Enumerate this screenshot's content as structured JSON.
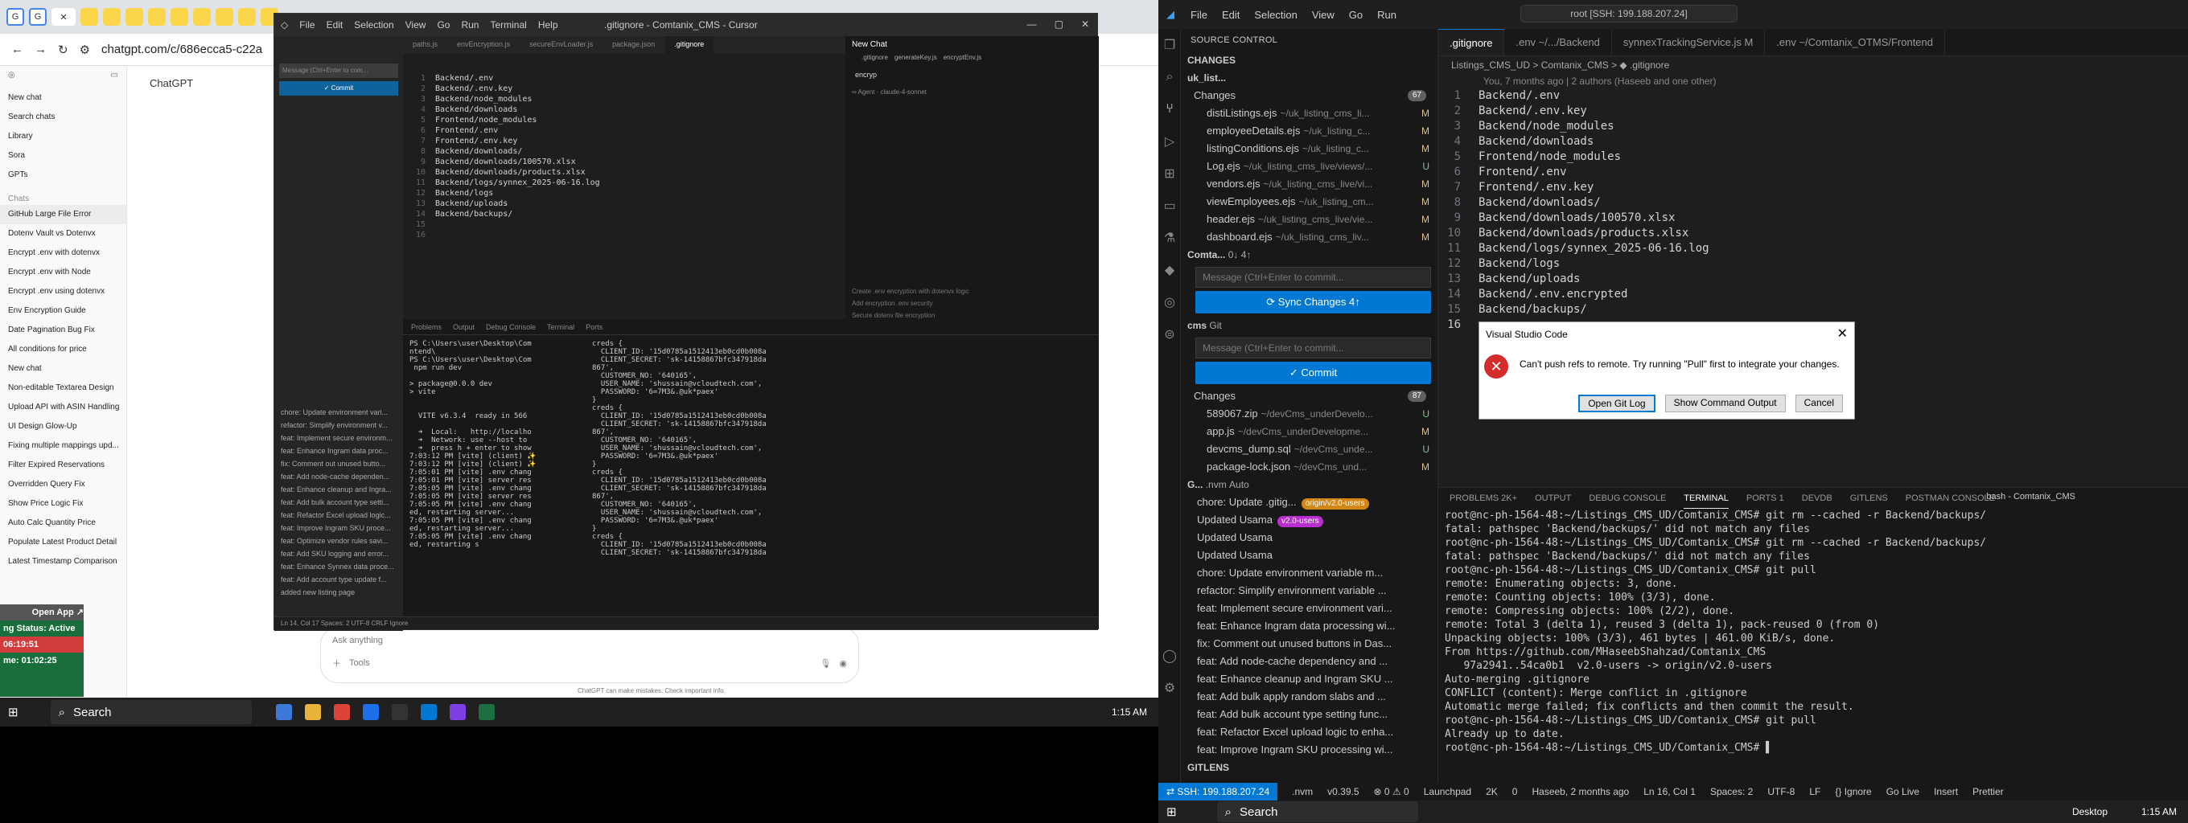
{
  "chrome": {
    "url": "chatgpt.com/c/686ecca5-c22a",
    "app_title": "ChatGPT"
  },
  "gpt_sidebar": {
    "top_items": [
      "New chat",
      "Search chats",
      "Library",
      "Sora",
      "GPTs"
    ],
    "chats_header": "Chats",
    "chats": [
      "GitHub Large File Error",
      "Dotenv Vault vs Dotenvx",
      "Encrypt .env with dotenvx",
      "Encrypt .env with Node",
      "Encrypt .env using dotenvx",
      "Env Encryption Guide",
      "Date Pagination Bug Fix",
      "All conditions for price",
      "New chat",
      "Non-editable Textarea Design",
      "Upload API with ASIN Handling",
      "UI Design Glow-Up",
      "Fixing multiple mappings upd...",
      "Filter Expired Reservations",
      "Overridden Query Fix",
      "Show Price Logic Fix",
      "Auto Calc Quantity Price",
      "Populate Latest Product Detail",
      "Latest Timestamp Comparison"
    ]
  },
  "gpt_main": {
    "input_placeholder": "Ask anything",
    "tools_label": "Tools",
    "footer": "ChatGPT can make mistakes. Check important info."
  },
  "status_widget": {
    "open_app": "Open App ↗",
    "status": "ng Status: Active",
    "time1": "06:19:51",
    "time2": "me: 01:02:25"
  },
  "cursor": {
    "menu": [
      "File",
      "Edit",
      "Selection",
      "View",
      "Go",
      "Run",
      "Terminal",
      "Help"
    ],
    "title": ".gitignore - Comtanix_CMS - Cursor",
    "tabs": [
      "paths.js",
      "envEncryption.js",
      "secureEnvLoader.js",
      "package.json",
      ".gitignore"
    ],
    "editor_lines": [
      "Backend/.env",
      "Backend/.env.key",
      "Backend/node_modules",
      "Backend/downloads",
      "Frontend/node_modules",
      "Frontend/.env",
      "Frontend/.env.key",
      "Backend/downloads/",
      "Backend/downloads/100570.xlsx",
      "Backend/downloads/products.xlsx",
      "Backend/logs/synnex_2025-06-16.log",
      "Backend/logs",
      "Backend/uploads",
      "Backend/backups/",
      "",
      ""
    ],
    "chat_title": "New Chat",
    "chat_tabs": [
      ".gitignore",
      "generateKey.js",
      "encryptEnv.js"
    ],
    "chat_input": "encryp",
    "chat_footer": [
      "Create .env encryption with dotenvx logic",
      "Add encryption .env security",
      "Secure dotenv file encryption"
    ],
    "term_tabs": [
      "Problems",
      "Output",
      "Debug Console",
      "Terminal",
      "Ports"
    ],
    "term_left": "PS C:\\Users\\user\\Desktop\\Com\nntend\\\nPS C:\\Users\\user\\Desktop\\Com\n npm run dev\n\n> package@0.0.0 dev\n> vite\n\n\n  VITE v6.3.4  ready in 566\n\n  ➜  Local:   http://localho\n  ➜  Network: use --host to\n  ➜  press h + enter to show\n7:03:12 PM [vite] (client) ✨\n7:03:12 PM [vite] (client) ✨\n7:05:01 PM [vite] .env chang\n7:05:01 PM [vite] server res\n7:05:05 PM [vite] .env chang\n7:05:05 PM [vite] server res\n7:05:05 PM [vite] .env chang\ned, restarting server...\n7:05:05 PM [vite] .env chang\ned, restarting server...\n7:05:05 PM [vite] .env chang\ned, restarting s",
    "term_right": "creds {\n  CLIENT_ID: '15d0785a1512413eb0cd0b008a\n  CLIENT_SECRET: 'sk-14158867bfc347918da\n867',\n  CUSTOMER_NO: '640165',\n  USER_NAME: 'shussain@vcloudtech.com',\n  PASSWORD: '6=7M3&.@uk*paex'\n}\ncreds {\n  CLIENT_ID: '15d0785a1512413eb0cd0b008a\n  CLIENT_SECRET: 'sk-14158867bfc347918da\n867',\n  CUSTOMER_NO: '640165',\n  USER_NAME: 'shussain@vcloudtech.com',\n  PASSWORD: '6=7M3&.@uk*paex'\n}\ncreds {\n  CLIENT_ID: '15d0785a1512413eb0cd0b008a\n  CLIENT_SECRET: 'sk-14158867bfc347918da\n867',\n  CUSTOMER_NO: '640165',\n  USER_NAME: 'shussain@vcloudtech.com',\n  PASSWORD: '6=7M3&.@uk*paex'\n}\ncreds {\n  CLIENT_ID: '15d0785a1512413eb0cd0b008a\n  CLIENT_SECRET: 'sk-14158867bfc347918da",
    "git_items": [
      "chore: Update environment vari...",
      "refactor: Simplify environment v...",
      "feat: Implement secure environm...",
      "feat: Enhance Ingram data proc...",
      "fix: Comment out unused butto...",
      "feat: Add node-cache dependen...",
      "feat: Enhance cleanup and Ingra...",
      "feat: Add bulk account type setti...",
      "feat: Refactor Excel upload logic...",
      "feat: Improve Ingram SKU proce...",
      "feat: Optimize vendor rules savi...",
      "feat: Add SKU logging and error...",
      "feat: Enhance Synnex data proce...",
      "feat: Add account type update f...",
      "added new listing page"
    ],
    "status": "Ln 14, Col 17   Spaces: 2   UTF-8   CRLF   Ignore"
  },
  "taskbar_left": {
    "search": "Search",
    "time": "1:15 AM"
  },
  "vscode": {
    "menu": [
      "File",
      "Edit",
      "Selection",
      "View",
      "Go",
      "Run"
    ],
    "command_center": "root [SSH: 199.188.207.24]",
    "sc_header": "SOURCE CONTROL",
    "changes_header": "CHANGES",
    "repo1": "uk_list...",
    "repo1_changes_label": "Changes",
    "repo1_badge": "67",
    "repo1_files": [
      {
        "name": "distiListings.ejs",
        "dir": "~/uk_listing_cms_li...",
        "st": "M"
      },
      {
        "name": "employeeDetails.ejs",
        "dir": "~/uk_listing_c...",
        "st": "M"
      },
      {
        "name": "listingConditions.ejs",
        "dir": "~/uk_listing_c...",
        "st": "M"
      },
      {
        "name": "Log.ejs",
        "dir": "~/uk_listing_cms_live/views/...",
        "st": "U"
      },
      {
        "name": "vendors.ejs",
        "dir": "~/uk_listing_cms_live/vi...",
        "st": "M"
      },
      {
        "name": "viewEmployees.ejs",
        "dir": "~/uk_listing_cm...",
        "st": "M"
      },
      {
        "name": "header.ejs",
        "dir": "~/uk_listing_cms_live/vie...",
        "st": "M"
      },
      {
        "name": "dashboard.ejs",
        "dir": "~/uk_listing_cms_liv...",
        "st": "M"
      }
    ],
    "repo2": "Comta...",
    "repo2_branch": "0↓ 4↑",
    "msg_placeholder": "Message (Ctrl+Enter to commit...",
    "sync_button": "⟳ Sync Changes 4↑",
    "repo3": "cms",
    "repo3_branch": "Git",
    "commit_button": "✓ Commit",
    "repo3_changes_label": "Changes",
    "repo3_badge": "87",
    "repo3_files": [
      {
        "name": "589067.zip",
        "dir": "~/devCms_underDevelo...",
        "st": "U"
      },
      {
        "name": "app.js",
        "dir": "~/devCms_underDevelopme...",
        "st": "M"
      },
      {
        "name": "devcms_dump.sql",
        "dir": "~/devCms_unde...",
        "st": "U"
      },
      {
        "name": "package-lock.json",
        "dir": "~/devCms_und...",
        "st": "M"
      }
    ],
    "graph_header": "G...",
    "graph_repo": ".nvm",
    "graph_mode": "Auto",
    "graph": [
      {
        "text": "chore: Update .gitig...",
        "tag": "origin/v2.0-users",
        "tagclass": ""
      },
      {
        "text": "Updated  Usama",
        "tag": "v2.0-users",
        "tagclass": "p"
      },
      {
        "text": "Updated  Usama",
        "tag": "",
        "tagclass": ""
      },
      {
        "text": "Updated  Usama",
        "tag": "",
        "tagclass": ""
      },
      {
        "text": "chore: Update environment variable m...",
        "tag": "",
        "tagclass": ""
      },
      {
        "text": "refactor: Simplify environment variable ...",
        "tag": "",
        "tagclass": ""
      },
      {
        "text": "feat: Implement secure environment vari...",
        "tag": "",
        "tagclass": ""
      },
      {
        "text": "feat: Enhance Ingram data processing wi...",
        "tag": "",
        "tagclass": ""
      },
      {
        "text": "fix: Comment out unused buttons in Das...",
        "tag": "",
        "tagclass": ""
      },
      {
        "text": "feat: Add node-cache dependency and ...",
        "tag": "",
        "tagclass": ""
      },
      {
        "text": "feat: Enhance cleanup and Ingram SKU ...",
        "tag": "",
        "tagclass": ""
      },
      {
        "text": "feat: Add bulk apply random slabs and ...",
        "tag": "",
        "tagclass": ""
      },
      {
        "text": "feat: Add bulk account type setting func...",
        "tag": "",
        "tagclass": ""
      },
      {
        "text": "feat: Refactor Excel upload logic to enha...",
        "tag": "",
        "tagclass": ""
      },
      {
        "text": "feat: Improve Ingram SKU processing wi...",
        "tag": "",
        "tagclass": ""
      }
    ],
    "gitlens": "GITLENS",
    "tabs": [
      ".gitignore",
      ".env ~/.../Backend",
      "synnexTrackingService.js M",
      ".env ~/Comtanix_OTMS/Frontend"
    ],
    "crumb": "Listings_CMS_UD > Comtanix_CMS > ◆ .gitignore",
    "blame": "You, 7 months ago | 2 authors (Haseeb and one other)",
    "code": [
      "Backend/.env",
      "Backend/.env.key",
      "Backend/node_modules",
      "Backend/downloads",
      "Frontend/node_modules",
      "Frontend/.env",
      "Frontend/.env.key",
      "Backend/downloads/",
      "Backend/downloads/100570.xlsx",
      "Backend/downloads/products.xlsx",
      "Backend/logs/synnex_2025-06-16.log",
      "Backend/logs",
      "Backend/uploads",
      "Backend/.env.encrypted",
      "Backend/backups/",
      ""
    ],
    "dialog": {
      "title": "Visual Studio Code",
      "message": "Can't push refs to remote. Try running \"Pull\" first to integrate your changes.",
      "buttons": [
        "Open Git Log",
        "Show Command Output",
        "Cancel"
      ]
    },
    "panel_tabs": [
      "PROBLEMS 2K+",
      "OUTPUT",
      "DEBUG CONSOLE",
      "TERMINAL",
      "PORTS 1",
      "DEVDB",
      "GITLENS",
      "POSTMAN CONSOLE"
    ],
    "panel_right": "bash - Comtanix_CMS",
    "terminal": "root@nc-ph-1564-48:~/Listings_CMS_UD/Comtanix_CMS# git rm --cached -r Backend/backups/\nfatal: pathspec 'Backend/backups/' did not match any files\nroot@nc-ph-1564-48:~/Listings_CMS_UD/Comtanix_CMS# git rm --cached -r Backend/backups/\nfatal: pathspec 'Backend/backups/' did not match any files\nroot@nc-ph-1564-48:~/Listings_CMS_UD/Comtanix_CMS# git pull\nremote: Enumerating objects: 3, done.\nremote: Counting objects: 100% (3/3), done.\nremote: Compressing objects: 100% (2/2), done.\nremote: Total 3 (delta 1), reused 3 (delta 1), pack-reused 0 (from 0)\nUnpacking objects: 100% (3/3), 461 bytes | 461.00 KiB/s, done.\nFrom https://github.com/MHaseebShahzad/Comtanix_CMS\n   97a2941..54ca0b1  v2.0-users -> origin/v2.0-users\nAuto-merging .gitignore\nCONFLICT (content): Merge conflict in .gitignore\nAutomatic merge failed; fix conflicts and then commit the result.\nroot@nc-ph-1564-48:~/Listings_CMS_UD/Comtanix_CMS# git pull\nAlready up to date.\nroot@nc-ph-1564-48:~/Listings_CMS_UD/Comtanix_CMS# ▌",
    "status_remote": "⇄ SSH: 199.188.207.24",
    "status_items": [
      ".nvm",
      "v0.39.5",
      "⊗ 0 ⚠ 0",
      "Launchpad",
      "2K",
      "0",
      "Haseeb, 2 months ago",
      "Ln 16, Col 1",
      "Spaces: 2",
      "UTF-8",
      "LF",
      "{} Ignore",
      "Go Live",
      "Insert",
      "Prettier"
    ]
  },
  "taskbar_right": {
    "search": "Search",
    "desktop": "Desktop",
    "time": "1:15 AM"
  }
}
